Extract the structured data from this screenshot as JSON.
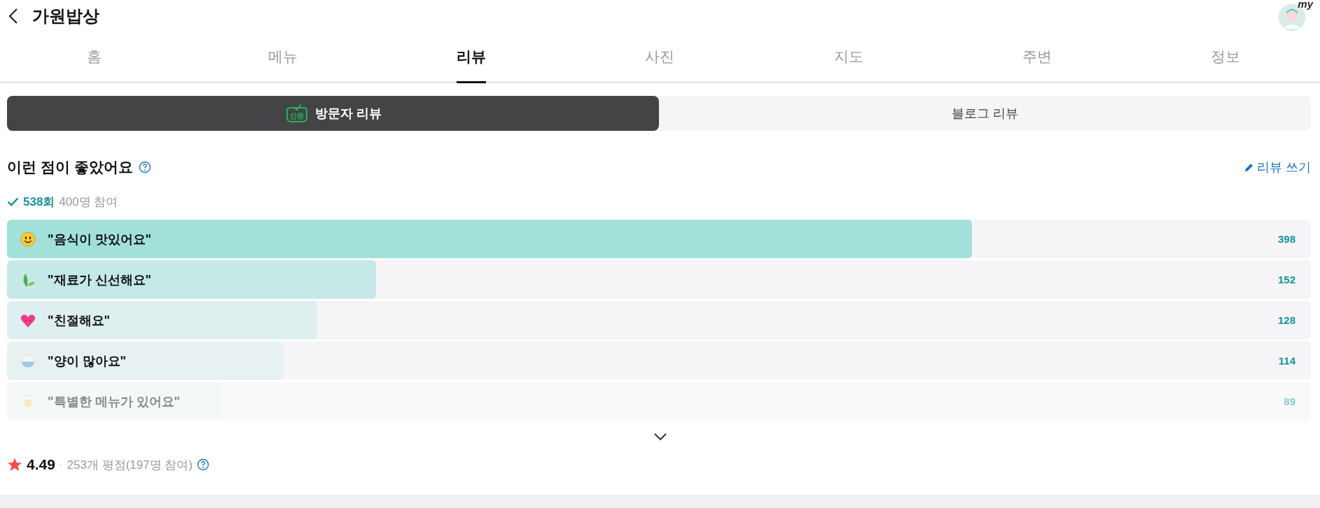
{
  "header": {
    "title": "가원밥상",
    "avatar_badge": "my"
  },
  "tabs": [
    {
      "label": "홈",
      "selected": false
    },
    {
      "label": "메뉴",
      "selected": false
    },
    {
      "label": "리뷰",
      "selected": true
    },
    {
      "label": "사진",
      "selected": false
    },
    {
      "label": "지도",
      "selected": false
    },
    {
      "label": "주변",
      "selected": false
    },
    {
      "label": "정보",
      "selected": false
    }
  ],
  "review_types": [
    {
      "label": "방문자 리뷰",
      "badge": "인증",
      "selected": true
    },
    {
      "label": "블로그 리뷰",
      "selected": false
    }
  ],
  "section": {
    "title": "이런 점이 좋았어요",
    "write_link": "리뷰 쓰기",
    "count": "538회",
    "participants": "400명 참여"
  },
  "keywords": [
    {
      "kind": "smile",
      "label": "\"음식이 맛있어요\"",
      "count": "398",
      "level": 0.74,
      "color": "#a2e0da",
      "faded": false
    },
    {
      "kind": "leaf",
      "label": "\"재료가 신선해요\"",
      "count": "152",
      "level": 0.283,
      "color": "#c4e9e6",
      "faded": false
    },
    {
      "kind": "heart",
      "label": "\"친절해요\"",
      "count": "128",
      "level": 0.238,
      "color": "#ddf0ef",
      "faded": false
    },
    {
      "kind": "rice",
      "label": "\"양이 많아요\"",
      "count": "114",
      "level": 0.212,
      "color": "#e7f1f2",
      "faded": false
    },
    {
      "kind": "chef",
      "label": "\"특별한 메뉴가 있어요\"",
      "count": "89",
      "level": 0.165,
      "color": "#eaf3f4",
      "faded": true
    }
  ],
  "rating": {
    "score": "4.49",
    "separator": "·",
    "summary": "253개 평점(197명 참여)"
  }
}
